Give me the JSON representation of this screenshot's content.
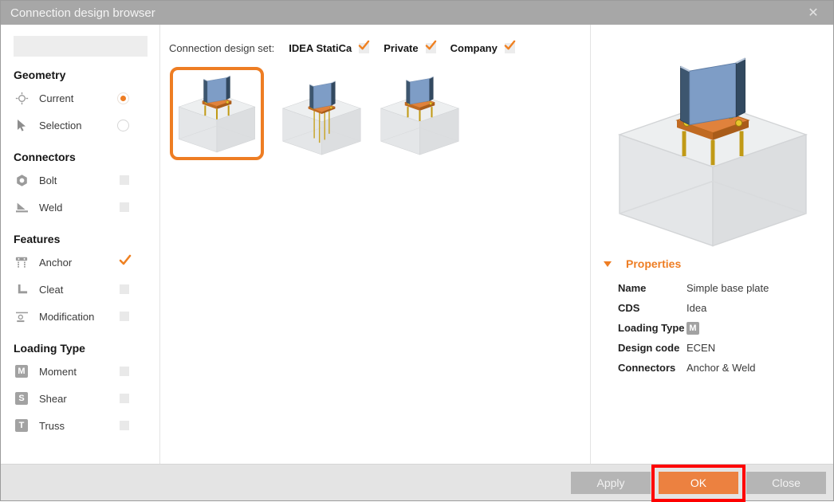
{
  "window": {
    "title": "Connection design browser",
    "close_glyph": "✕"
  },
  "topbar": {
    "label": "Connection design set:",
    "sets": [
      {
        "name": "IDEA StatiCa",
        "checked": true
      },
      {
        "name": "Private",
        "checked": true
      },
      {
        "name": "Company",
        "checked": true
      }
    ]
  },
  "sidebar": {
    "search": {
      "placeholder": ""
    },
    "sections": [
      {
        "title": "Geometry",
        "items": [
          {
            "label": "Current",
            "icon": "target-move-icon",
            "control": "radio",
            "selected": true
          },
          {
            "label": "Selection",
            "icon": "cursor-icon",
            "control": "radio",
            "selected": false
          }
        ]
      },
      {
        "title": "Connectors",
        "items": [
          {
            "label": "Bolt",
            "icon": "bolt-nut-icon",
            "control": "checkbox",
            "checked": false
          },
          {
            "label": "Weld",
            "icon": "weld-icon",
            "control": "checkbox",
            "checked": false
          }
        ]
      },
      {
        "title": "Features",
        "items": [
          {
            "label": "Anchor",
            "icon": "anchor-plate-icon",
            "control": "checkbox",
            "checked": true
          },
          {
            "label": "Cleat",
            "icon": "cleat-angle-icon",
            "control": "checkbox",
            "checked": false
          },
          {
            "label": "Modification",
            "icon": "modification-icon",
            "control": "checkbox",
            "checked": false
          }
        ]
      },
      {
        "title": "Loading Type",
        "items": [
          {
            "label": "Moment",
            "badge": "M",
            "control": "checkbox",
            "checked": false
          },
          {
            "label": "Shear",
            "badge": "S",
            "control": "checkbox",
            "checked": false
          },
          {
            "label": "Truss",
            "badge": "T",
            "control": "checkbox",
            "checked": false
          }
        ]
      }
    ]
  },
  "gallery": {
    "thumbnails": [
      {
        "selected": true
      },
      {
        "selected": false
      },
      {
        "selected": false
      }
    ]
  },
  "properties": {
    "header": "Properties",
    "rows": [
      {
        "label": "Name",
        "value": "Simple base plate"
      },
      {
        "label": "CDS",
        "value": "Idea"
      },
      {
        "label": "Loading Type",
        "value": "M",
        "is_badge": true
      },
      {
        "label": "Design code",
        "value": "ECEN"
      },
      {
        "label": "Connectors",
        "value": "Anchor & Weld"
      }
    ]
  },
  "footer": {
    "apply": "Apply",
    "ok": "OK",
    "close": "Close"
  },
  "colors": {
    "accent": "#ee7d23",
    "ok_button": "#ec8140",
    "annotation": "#fe0000",
    "titlebar": "#a7a7a7"
  }
}
